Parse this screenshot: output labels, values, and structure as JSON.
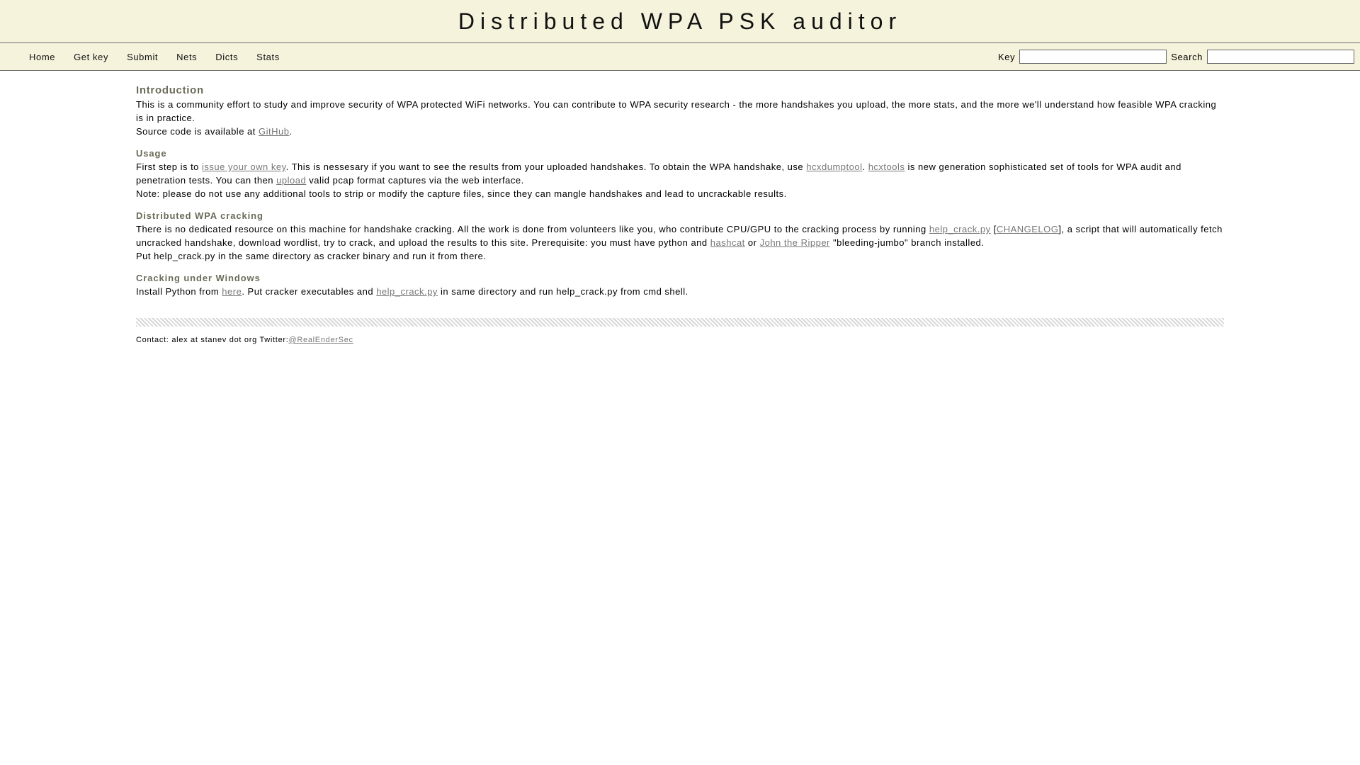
{
  "header": {
    "title": "Distributed WPA PSK auditor"
  },
  "nav": {
    "items": [
      {
        "label": "Home"
      },
      {
        "label": "Get key"
      },
      {
        "label": "Submit"
      },
      {
        "label": "Nets"
      },
      {
        "label": "Dicts"
      },
      {
        "label": "Stats"
      }
    ],
    "key_label": "Key",
    "key_value": "",
    "search_label": "Search",
    "search_value": ""
  },
  "intro": {
    "title": "Introduction",
    "p1": "This is a community effort to study and improve security of WPA protected WiFi networks. You can contribute to WPA security research - the more handshakes you upload, the more stats, and the more we'll understand how feasible WPA cracking is in practice.",
    "p2_pre": "Source code is available at ",
    "p2_link": "GitHub",
    "p2_post": "."
  },
  "usage": {
    "title": "Usage",
    "s1_pre": "First step is to ",
    "s1_link": "issue your own key",
    "s1_mid": ". This is nessesary if you want to see the results from your uploaded handshakes. To obtain the WPA handshake, use ",
    "s1_link2": "hcxdumptool",
    "s1_sep": ". ",
    "s1_link3": "hcxtools",
    "s1_mid2": " is new generation sophisticated set of tools for WPA audit and penetration tests. You can then ",
    "s1_link4": "upload",
    "s1_post": " valid pcap format captures via the web interface.",
    "note": "Note: please do not use any additional tools to strip or modify the capture files, since they can mangle handshakes and lead to uncrackable results."
  },
  "distributed": {
    "title": "Distributed WPA cracking",
    "p1_pre": "There is no dedicated resource on this machine for handshake cracking. All the work is done from volunteers like you, who contribute CPU/GPU to the cracking process by running ",
    "p1_link": "help_crack.py",
    "p1_bracket_open": " [",
    "p1_link2": "CHANGELOG",
    "p1_mid": "], a script that will automatically fetch uncracked handshake, download wordlist, try to crack, and upload the results to this site. Prerequisite: you must have python and ",
    "p1_link3": "hashcat",
    "p1_or": " or ",
    "p1_link4": "John the Ripper",
    "p1_post": " \"bleeding-jumbo\" branch installed.",
    "p2": "Put help_crack.py in the same directory as cracker binary and run it from there."
  },
  "windows": {
    "title": "Cracking under Windows",
    "p_pre": "Install Python from ",
    "p_link": "here",
    "p_mid": ". Put cracker executables and ",
    "p_link2": "help_crack.py",
    "p_post": " in same directory and run help_crack.py from cmd shell."
  },
  "footer": {
    "contact": "Contact: alex at stanev dot org Twitter:",
    "twitter": "@RealEnderSec"
  }
}
